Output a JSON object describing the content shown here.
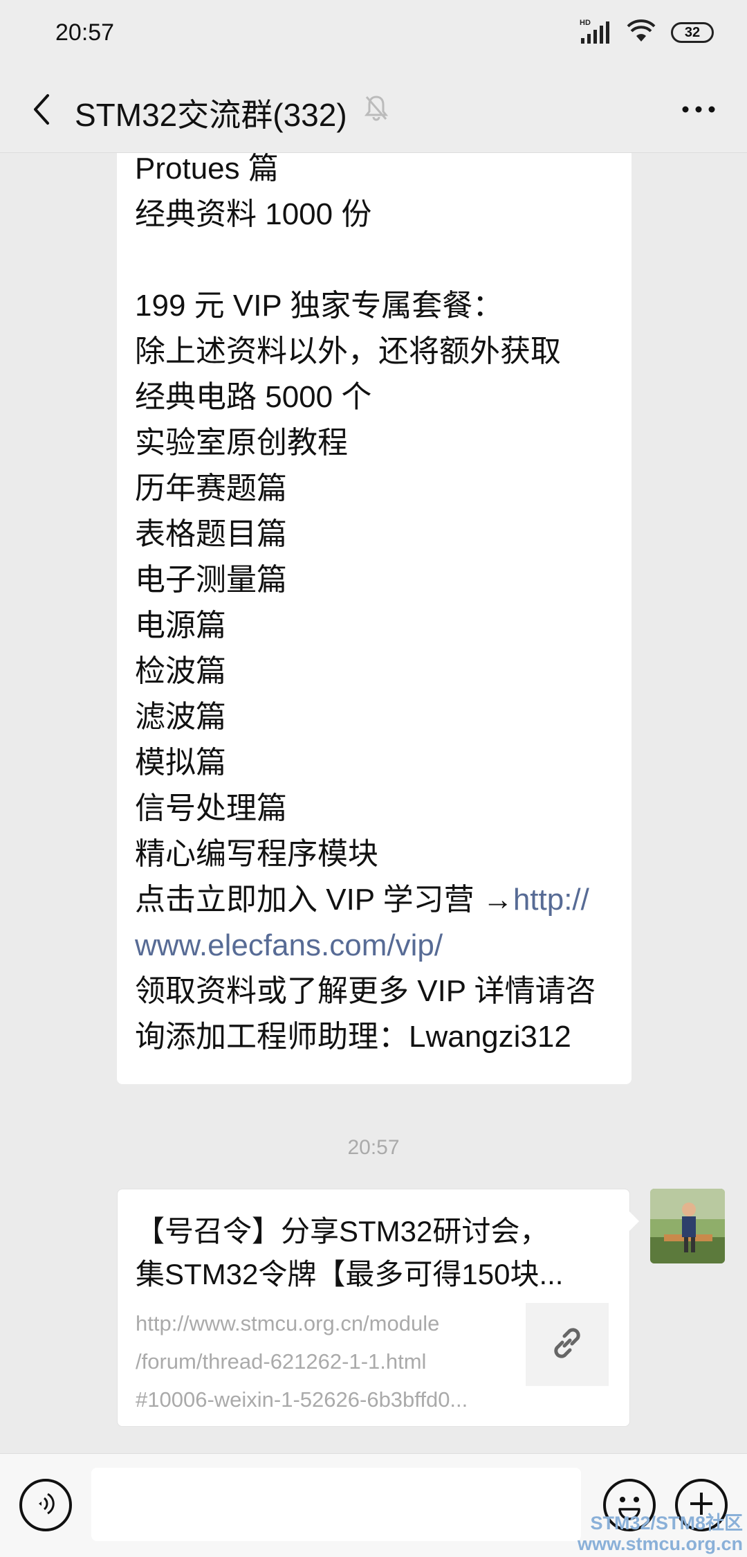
{
  "status_bar": {
    "time": "20:57",
    "signal_label": "HD",
    "battery": "32"
  },
  "nav": {
    "title": "STM32交流群(332)"
  },
  "message": {
    "lines": [
      "Protues 篇",
      "经典资料 1000 份",
      "",
      "199 元 VIP 独家专属套餐：",
      "除上述资料以外，还将额外获取",
      "经典电路 5000 个",
      "实验室原创教程",
      "历年赛题篇",
      "表格题目篇",
      "电子测量篇",
      "电源篇",
      "检波篇",
      "滤波篇",
      "模拟篇",
      "信号处理篇",
      "精心编写程序模块"
    ],
    "cta_text": "点击立即加入 VIP 学习营 →",
    "link_part1": "http://",
    "link_part2": "www.elecfans.com/vip/",
    "contact_line1": "领取资料或了解更多 VIP 详情请咨",
    "contact_line2": "询添加工程师助理：Lwangzi312"
  },
  "time_divider": "20:57",
  "link_card": {
    "title_line1": "【号召令】分享STM32研讨会，",
    "title_line2": "集STM32令牌【最多可得150块...",
    "url_line1": "http://www.stmcu.org.cn/module",
    "url_line2": "/forum/thread-621262-1-1.html",
    "url_line3": "#10006-weixin-1-52626-6b3bffd0..."
  },
  "watermark": {
    "line1": "STM32/STM8社区",
    "line2": "www.stmcu.org.cn"
  },
  "colors": {
    "link": "#576b95",
    "background": "#ededed",
    "bubble": "#ffffff"
  },
  "icons": [
    "back-icon",
    "mute-bell-icon",
    "more-icon",
    "voice-icon",
    "emoji-icon",
    "plus-icon",
    "link-icon",
    "signal-icon",
    "wifi-icon",
    "battery-icon"
  ]
}
